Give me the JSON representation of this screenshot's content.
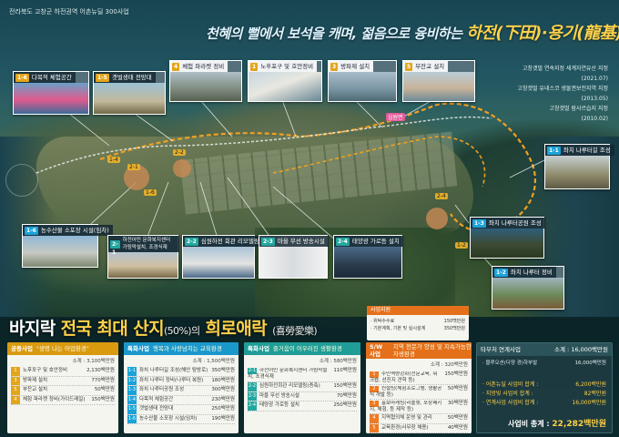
{
  "header": {
    "label": "전라북도 고창군 하전권역 어촌뉴딜 300사업",
    "slogan_pre": "천혜의 뻘에서 보석을 캐며, 젊음으로 융비하는",
    "slogan_place": "하전(下田)·용기(龍基) 포구",
    "info_lines": [
      "고창갯벌 연속지정 세계자연유산 지정",
      "(2021.07)",
      "고창갯벌 유네스코 생물권보전지역 지정",
      "(2013.05)",
      "고창갯벌 람사르습지 지정",
      "(2010.02)"
    ]
  },
  "map_cards": [
    {
      "num": "1-6",
      "label": "다목적 체험공간",
      "type": "g"
    },
    {
      "num": "1-5",
      "label": "갯벌생태 전망대",
      "type": "g"
    },
    {
      "num": "4",
      "label": "체험 파라켓 정비",
      "type": "g"
    },
    {
      "num": "1",
      "label": "노후포구 및 호안정비",
      "type": "g"
    },
    {
      "num": "3",
      "label": "방파제 설치",
      "type": "g"
    },
    {
      "num": "5",
      "label": "부잔교 설치",
      "type": "g"
    },
    {
      "num": "1-1",
      "label": "좌치 나루터길 조성",
      "type": "b"
    },
    {
      "num": "1-3",
      "label": "좌치 나루터공원 조성",
      "type": "b"
    },
    {
      "num": "1-2",
      "label": "좌치 나루터 정비",
      "type": "b"
    },
    {
      "num": "1-6",
      "label": "농수산물 소포장 시설(임차)",
      "type": "b"
    },
    {
      "num": "2-1",
      "label": "하전어민 문화복지센터 가림막설치, 조경식재",
      "type": "t"
    },
    {
      "num": "2-2",
      "label": "심원하전 회관 리모델링",
      "type": "t"
    },
    {
      "num": "2-3",
      "label": "마을 무선 방송시설",
      "type": "t"
    },
    {
      "num": "2-4",
      "label": "태양광 가로등 설치",
      "type": "t"
    }
  ],
  "map_markers": [
    "2-1",
    "2-2",
    "1-4",
    "1-6",
    "심원면",
    "2-4",
    "1-2"
  ],
  "title": {
    "pre": "바지락",
    "highlight": "전국 최대 산지",
    "percent": "(50%)의",
    "highlight2": "희로애락",
    "hanja": "(喜勞愛樂)"
  },
  "support": {
    "header": "사업지원",
    "rows": [
      {
        "label": "· 위탁수수료",
        "value": "150백만원"
      },
      {
        "label": "· 기본계획, 기본 및 실시설계",
        "value": "350백만원"
      }
    ]
  },
  "boxes": [
    {
      "label": "공동사업",
      "desc": "\"생명 나는 어업환경\"",
      "sub": "소계 : 3,100백만원",
      "cls": "gold",
      "items": [
        {
          "n": "1",
          "l": "노후포구 및 호안정비",
          "v": "2,130백만원"
        },
        {
          "n": "3",
          "l": "방파제 설치",
          "v": "770백만원"
        },
        {
          "n": "5",
          "l": "부잔교 설치",
          "v": "50백만원"
        },
        {
          "n": "4",
          "l": "체험 파라켓 정비(가이드레일)",
          "v": "150백만원"
        }
      ]
    },
    {
      "label": "특화사업",
      "desc": "행복과 사랑넘치는 교육환경",
      "sub": "소계 : 1,500백만원",
      "cls": "blue",
      "items": [
        {
          "n": "1-1",
          "l": "좌치 나루터길 조성(해안 탐방로)",
          "v": "350백만원"
        },
        {
          "n": "1-2",
          "l": "좌치 나루터 정비(나루터 복원)",
          "v": "180백만원"
        },
        {
          "n": "1-3",
          "l": "좌치 나루터공원 조성",
          "v": "300백만원"
        },
        {
          "n": "1-4",
          "l": "다목적 체험공간",
          "v": "230백만원"
        },
        {
          "n": "1-5",
          "l": "갯벌생태 전망대",
          "v": "250백만원"
        },
        {
          "n": "1-6",
          "l": "농수산물 소포장 시설(임차)",
          "v": "190백만원"
        }
      ]
    },
    {
      "label": "특화사업",
      "desc": "즐거움이 어우러진 생활환경",
      "sub": "소계 : 580백만원",
      "cls": "teal",
      "items": [
        {
          "n": "2-1",
          "l": "하전어민 문화복지센터 가림막설치, 조경식재",
          "v": "110백만원"
        },
        {
          "n": "2-2",
          "l": "심원하전회관 리모델링(증축)",
          "v": "150백만원"
        },
        {
          "n": "2-3",
          "l": "마을 무선 방송시설",
          "v": "70백만원"
        },
        {
          "n": "2-4",
          "l": "태양광 가로등 설치",
          "v": "250백만원"
        }
      ]
    },
    {
      "label": "S/W 사업",
      "desc": "지역 전문가 양성 및 지속가능한 자생환경",
      "sub": "소계 : 320백만원",
      "cls": "orange",
      "items": [
        {
          "n": "1",
          "l": "주민역량강화(전문교육, 워크숍, 선진지 견학 등)",
          "v": "150백만원"
        },
        {
          "n": "2",
          "l": "컨설팅(체험프로그램, 생활공식 개발 등)",
          "v": "50백만원"
        },
        {
          "n": "3",
          "l": "홍보마케팅(리플렛, 포장패키지, 체험, 등 제작 등)",
          "v": "30백만원"
        },
        {
          "n": "4",
          "l": "지역협의체 운영 및 관리",
          "v": "50백만원"
        },
        {
          "n": "5",
          "l": "교육환경(사무장 채용)",
          "v": "40백만원"
        }
      ]
    }
  ],
  "other": {
    "header": "타부처 연계사업",
    "header_value": "소계 : 16,000백만원",
    "rows": [
      {
        "l": "· 블루오션(다양 경)하부발",
        "v": "16,000백만원"
      }
    ],
    "totals": [
      {
        "l": "· 어촌뉴딜 사업비 합계 :",
        "v": "6,200백만원"
      },
      {
        "l": "· 지방빚 사업비 합계 :",
        "v": "82백만원"
      },
      {
        "l": "· 연계사업 사업비 합계 :",
        "v": "16,000백만원"
      }
    ],
    "grand_label": "사업비 총계 :",
    "grand_value": "22,282백만원"
  }
}
